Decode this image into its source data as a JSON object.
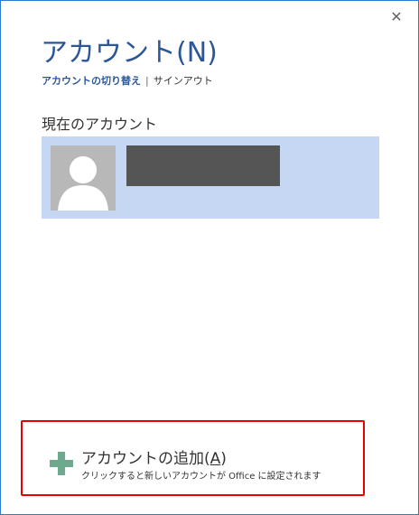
{
  "dialog": {
    "title": "アカウント(N)",
    "close_glyph": "✕"
  },
  "header_links": {
    "switch_account": "アカウントの切り替え",
    "separator": "|",
    "sign_out": "サインアウト"
  },
  "current_account": {
    "section_label": "現在のアカウント"
  },
  "add_account": {
    "title_prefix": "アカウントの追加(",
    "title_accel": "A",
    "title_suffix": ")",
    "description": "クリックすると新しいアカウントが Office に設定されます"
  },
  "colors": {
    "accent": "#2b579a",
    "selected_bg": "#c5d7f2",
    "plus_icon": "#6da98c",
    "highlight_border": "#e60000"
  }
}
